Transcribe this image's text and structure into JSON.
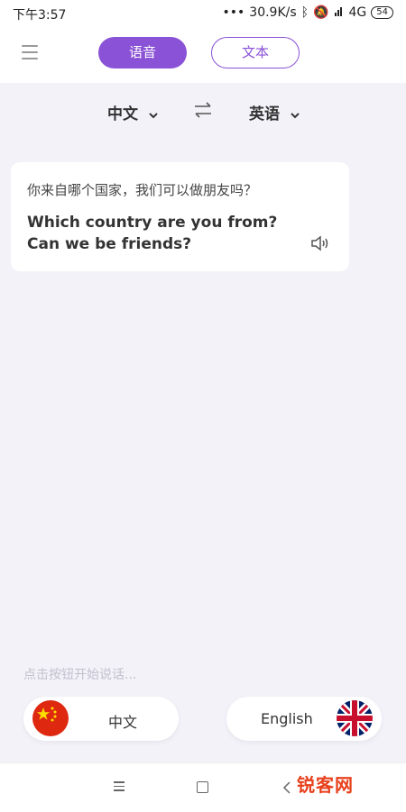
{
  "status": {
    "time": "下午3:57",
    "net_speed": "30.9K/s",
    "signal": "4G",
    "battery": "54"
  },
  "header": {
    "tabs": [
      {
        "label": "语音",
        "active": true
      },
      {
        "label": "文本",
        "active": false
      }
    ]
  },
  "languages": {
    "source": "中文",
    "target": "英语"
  },
  "card": {
    "source_text": "你来自哪个国家，我们可以做朋友吗？",
    "translated_text": "Which country are you from? Can we be friends?"
  },
  "hint": "点击按钮开始说话...",
  "lang_buttons": {
    "left_label": "中文",
    "right_label": "English"
  },
  "watermark": "锐客网",
  "colors": {
    "accent": "#8a52d6",
    "background": "#f3f2f9",
    "card": "#ffffff"
  }
}
